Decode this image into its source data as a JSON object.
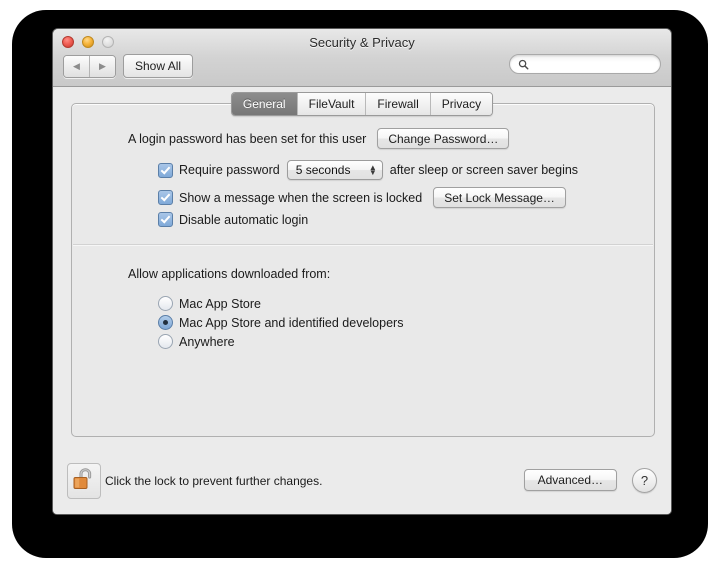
{
  "window": {
    "title": "Security & Privacy",
    "traffic_lights": [
      "close",
      "minimize",
      "zoom"
    ]
  },
  "toolbar": {
    "back_label": "◀",
    "forward_label": "▶",
    "show_all_label": "Show All",
    "search": {
      "value": "",
      "placeholder": ""
    }
  },
  "tabs": [
    {
      "label": "General",
      "selected": true
    },
    {
      "label": "FileVault",
      "selected": false
    },
    {
      "label": "Firewall",
      "selected": false
    },
    {
      "label": "Privacy",
      "selected": false
    }
  ],
  "general": {
    "login_password_text": "A login password has been set for this user",
    "change_password_label": "Change Password…",
    "require_password": {
      "checked": true,
      "label_before": "Require password",
      "interval_value": "5 seconds",
      "label_after": "after sleep or screen saver begins"
    },
    "show_message": {
      "checked": true,
      "label": "Show a message when the screen is locked",
      "button_label": "Set Lock Message…"
    },
    "disable_auto_login": {
      "checked": true,
      "label": "Disable automatic login"
    },
    "allow_apps_heading": "Allow applications downloaded from:",
    "allow_apps_options": [
      {
        "label": "Mac App Store",
        "selected": false
      },
      {
        "label": "Mac App Store and identified developers",
        "selected": true
      },
      {
        "label": "Anywhere",
        "selected": false
      }
    ]
  },
  "footer": {
    "lock_icon": "open-padlock-icon",
    "lock_text": "Click the lock to prevent further changes.",
    "advanced_label": "Advanced…",
    "help_label": "?"
  },
  "colors": {
    "window_bg": "#ebebeb",
    "panel_bg": "#e9e9e9",
    "selected_tab_bg": "#7f7f7f",
    "control_blue": "#7fa9d8",
    "backdrop": "#000000",
    "lock_body": "#e08a3c"
  }
}
